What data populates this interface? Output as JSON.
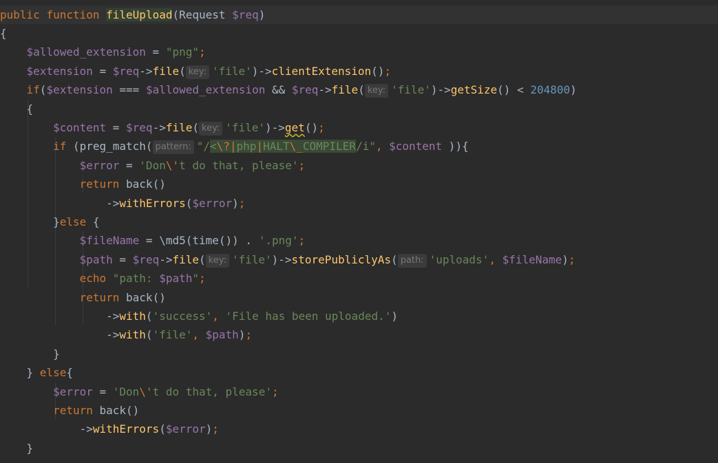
{
  "editor": {
    "lines": [
      {
        "tokens": [
          {
            "t": "public ",
            "c": "kw"
          },
          {
            "t": "function ",
            "c": "kw"
          },
          {
            "t": "fileUpload",
            "c": "fn-decl"
          },
          {
            "t": "(Request ",
            "c": "op"
          },
          {
            "t": "$req",
            "c": "var"
          },
          {
            "t": ")",
            "c": "op"
          }
        ]
      },
      {
        "tokens": [
          {
            "t": "{",
            "c": "op"
          }
        ]
      },
      {
        "tokens": [
          {
            "t": "    "
          },
          {
            "t": "$allowed_extension",
            "c": "var"
          },
          {
            "t": " = ",
            "c": "op"
          },
          {
            "t": "\"png\"",
            "c": "str"
          },
          {
            "t": ";",
            "c": "kw"
          }
        ]
      },
      {
        "tokens": [
          {
            "t": "    "
          },
          {
            "t": "$extension",
            "c": "var"
          },
          {
            "t": " = ",
            "c": "op"
          },
          {
            "t": "$req",
            "c": "var"
          },
          {
            "t": "->",
            "c": "op"
          },
          {
            "t": "file",
            "c": "fn"
          },
          {
            "t": "(",
            "c": "op"
          },
          {
            "hint": "key:"
          },
          {
            "t": "'file'",
            "c": "str"
          },
          {
            "t": ")->",
            "c": "op"
          },
          {
            "t": "clientExtension",
            "c": "fn"
          },
          {
            "t": "()",
            "c": "op"
          },
          {
            "t": ";",
            "c": "kw"
          }
        ]
      },
      {
        "tokens": [
          {
            "t": "    "
          },
          {
            "t": "if",
            "c": "kw"
          },
          {
            "t": "(",
            "c": "op"
          },
          {
            "t": "$extension",
            "c": "var"
          },
          {
            "t": " === ",
            "c": "op"
          },
          {
            "t": "$allowed_extension",
            "c": "var"
          },
          {
            "t": " && ",
            "c": "op"
          },
          {
            "t": "$req",
            "c": "var"
          },
          {
            "t": "->",
            "c": "op"
          },
          {
            "t": "file",
            "c": "fn"
          },
          {
            "t": "(",
            "c": "op"
          },
          {
            "hint": "key:"
          },
          {
            "t": "'file'",
            "c": "str"
          },
          {
            "t": ")->",
            "c": "op"
          },
          {
            "t": "getSize",
            "c": "fn"
          },
          {
            "t": "() < ",
            "c": "op"
          },
          {
            "t": "204800",
            "c": "num"
          },
          {
            "t": ")",
            "c": "op"
          }
        ]
      },
      {
        "tokens": [
          {
            "t": "    "
          },
          {
            "t": "{",
            "c": "op"
          }
        ]
      },
      {
        "tokens": [
          {
            "t": "        "
          },
          {
            "t": "$content",
            "c": "var"
          },
          {
            "t": " = ",
            "c": "op"
          },
          {
            "t": "$req",
            "c": "var"
          },
          {
            "t": "->",
            "c": "op"
          },
          {
            "t": "file",
            "c": "fn"
          },
          {
            "t": "(",
            "c": "op"
          },
          {
            "hint": "key:"
          },
          {
            "t": "'file'",
            "c": "str"
          },
          {
            "t": ")->",
            "c": "op"
          },
          {
            "t": "get",
            "c": "fn squiggle"
          },
          {
            "t": "()",
            "c": "op"
          },
          {
            "t": ";",
            "c": "kw"
          }
        ]
      },
      {
        "tokens": [
          {
            "t": "        "
          },
          {
            "t": "if ",
            "c": "kw"
          },
          {
            "t": "(preg_match(",
            "c": "op"
          },
          {
            "hint": "pattern:"
          },
          {
            "t": "\"/",
            "c": "str"
          },
          {
            "t": "<",
            "c": "regex-hl regex-str"
          },
          {
            "t": "\\?",
            "c": "regex-hl regex-meta"
          },
          {
            "t": "|",
            "c": "regex-hl regex-meta"
          },
          {
            "t": "php",
            "c": "regex-hl regex-str"
          },
          {
            "t": "|",
            "c": "regex-hl regex-meta"
          },
          {
            "t": "HALT",
            "c": "regex-hl regex-str"
          },
          {
            "t": "\\_",
            "c": "regex-hl regex-meta"
          },
          {
            "t": "COMPILER",
            "c": "regex-hl regex-str"
          },
          {
            "t": "/i\"",
            "c": "str"
          },
          {
            "t": ", ",
            "c": "kw"
          },
          {
            "t": "$content",
            "c": "var"
          },
          {
            "t": " )){",
            "c": "op"
          }
        ]
      },
      {
        "tokens": [
          {
            "t": "            "
          },
          {
            "t": "$error",
            "c": "var"
          },
          {
            "t": " = ",
            "c": "op"
          },
          {
            "t": "'Don",
            "c": "str"
          },
          {
            "t": "\\'",
            "c": "esc"
          },
          {
            "t": "t do that, please'",
            "c": "str"
          },
          {
            "t": ";",
            "c": "kw"
          }
        ]
      },
      {
        "tokens": [
          {
            "t": "            "
          },
          {
            "t": "return ",
            "c": "kw"
          },
          {
            "t": "back()",
            "c": "op"
          }
        ]
      },
      {
        "tokens": [
          {
            "t": "                "
          },
          {
            "t": "->",
            "c": "op"
          },
          {
            "t": "withErrors",
            "c": "fn"
          },
          {
            "t": "(",
            "c": "op"
          },
          {
            "t": "$error",
            "c": "var"
          },
          {
            "t": ")",
            "c": "op"
          },
          {
            "t": ";",
            "c": "kw"
          }
        ]
      },
      {
        "tokens": [
          {
            "t": "        "
          },
          {
            "t": "}",
            "c": "op"
          },
          {
            "t": "else",
            "c": "kw"
          },
          {
            "t": " {",
            "c": "op"
          }
        ]
      },
      {
        "tokens": [
          {
            "t": "            "
          },
          {
            "t": "$fileName",
            "c": "var"
          },
          {
            "t": " = \\md5(time()) . ",
            "c": "op"
          },
          {
            "t": "'.png'",
            "c": "str"
          },
          {
            "t": ";",
            "c": "kw"
          }
        ]
      },
      {
        "tokens": [
          {
            "t": "            "
          },
          {
            "t": "$path",
            "c": "var"
          },
          {
            "t": " = ",
            "c": "op"
          },
          {
            "t": "$req",
            "c": "var"
          },
          {
            "t": "->",
            "c": "op"
          },
          {
            "t": "file",
            "c": "fn"
          },
          {
            "t": "(",
            "c": "op"
          },
          {
            "hint": "key:"
          },
          {
            "t": "'file'",
            "c": "str"
          },
          {
            "t": ")->",
            "c": "op"
          },
          {
            "t": "storePubliclyAs",
            "c": "fn"
          },
          {
            "t": "(",
            "c": "op"
          },
          {
            "hint": "path:"
          },
          {
            "t": "'uploads'",
            "c": "str"
          },
          {
            "t": ", ",
            "c": "kw"
          },
          {
            "t": "$fileName",
            "c": "var"
          },
          {
            "t": ")",
            "c": "op"
          },
          {
            "t": ";",
            "c": "kw"
          }
        ]
      },
      {
        "tokens": [
          {
            "t": "            "
          },
          {
            "t": "echo ",
            "c": "kw"
          },
          {
            "t": "\"path: ",
            "c": "str"
          },
          {
            "t": "$path",
            "c": "var"
          },
          {
            "t": "\"",
            "c": "str"
          },
          {
            "t": ";",
            "c": "kw"
          }
        ]
      },
      {
        "tokens": [
          {
            "t": "            "
          },
          {
            "t": "return ",
            "c": "kw"
          },
          {
            "t": "back()",
            "c": "op"
          }
        ]
      },
      {
        "tokens": [
          {
            "t": "                "
          },
          {
            "t": "->",
            "c": "op"
          },
          {
            "t": "with",
            "c": "fn"
          },
          {
            "t": "(",
            "c": "op"
          },
          {
            "t": "'success'",
            "c": "str"
          },
          {
            "t": ", ",
            "c": "kw"
          },
          {
            "t": "'File has been uploaded.'",
            "c": "str"
          },
          {
            "t": ")",
            "c": "op"
          }
        ]
      },
      {
        "tokens": [
          {
            "t": "                "
          },
          {
            "t": "->",
            "c": "op"
          },
          {
            "t": "with",
            "c": "fn"
          },
          {
            "t": "(",
            "c": "op"
          },
          {
            "t": "'file'",
            "c": "str"
          },
          {
            "t": ", ",
            "c": "kw"
          },
          {
            "t": "$path",
            "c": "var"
          },
          {
            "t": ")",
            "c": "op"
          },
          {
            "t": ";",
            "c": "kw"
          }
        ]
      },
      {
        "tokens": [
          {
            "t": "        "
          },
          {
            "t": "}",
            "c": "op"
          }
        ]
      },
      {
        "tokens": [
          {
            "t": "    "
          },
          {
            "t": "} ",
            "c": "op"
          },
          {
            "t": "else",
            "c": "kw"
          },
          {
            "t": "{",
            "c": "op"
          }
        ]
      },
      {
        "tokens": [
          {
            "t": "        "
          },
          {
            "t": "$error",
            "c": "var"
          },
          {
            "t": " = ",
            "c": "op"
          },
          {
            "t": "'Don",
            "c": "str"
          },
          {
            "t": "\\'",
            "c": "esc"
          },
          {
            "t": "t do that, please'",
            "c": "str"
          },
          {
            "t": ";",
            "c": "kw"
          }
        ]
      },
      {
        "tokens": [
          {
            "t": "        "
          },
          {
            "t": "return ",
            "c": "kw"
          },
          {
            "t": "back()",
            "c": "op"
          }
        ]
      },
      {
        "tokens": [
          {
            "t": "            "
          },
          {
            "t": "->",
            "c": "op"
          },
          {
            "t": "withErrors",
            "c": "fn"
          },
          {
            "t": "(",
            "c": "op"
          },
          {
            "t": "$error",
            "c": "var"
          },
          {
            "t": ")",
            "c": "op"
          },
          {
            "t": ";",
            "c": "kw"
          }
        ]
      },
      {
        "tokens": [
          {
            "t": "    "
          },
          {
            "t": "}",
            "c": "op"
          }
        ]
      }
    ]
  }
}
